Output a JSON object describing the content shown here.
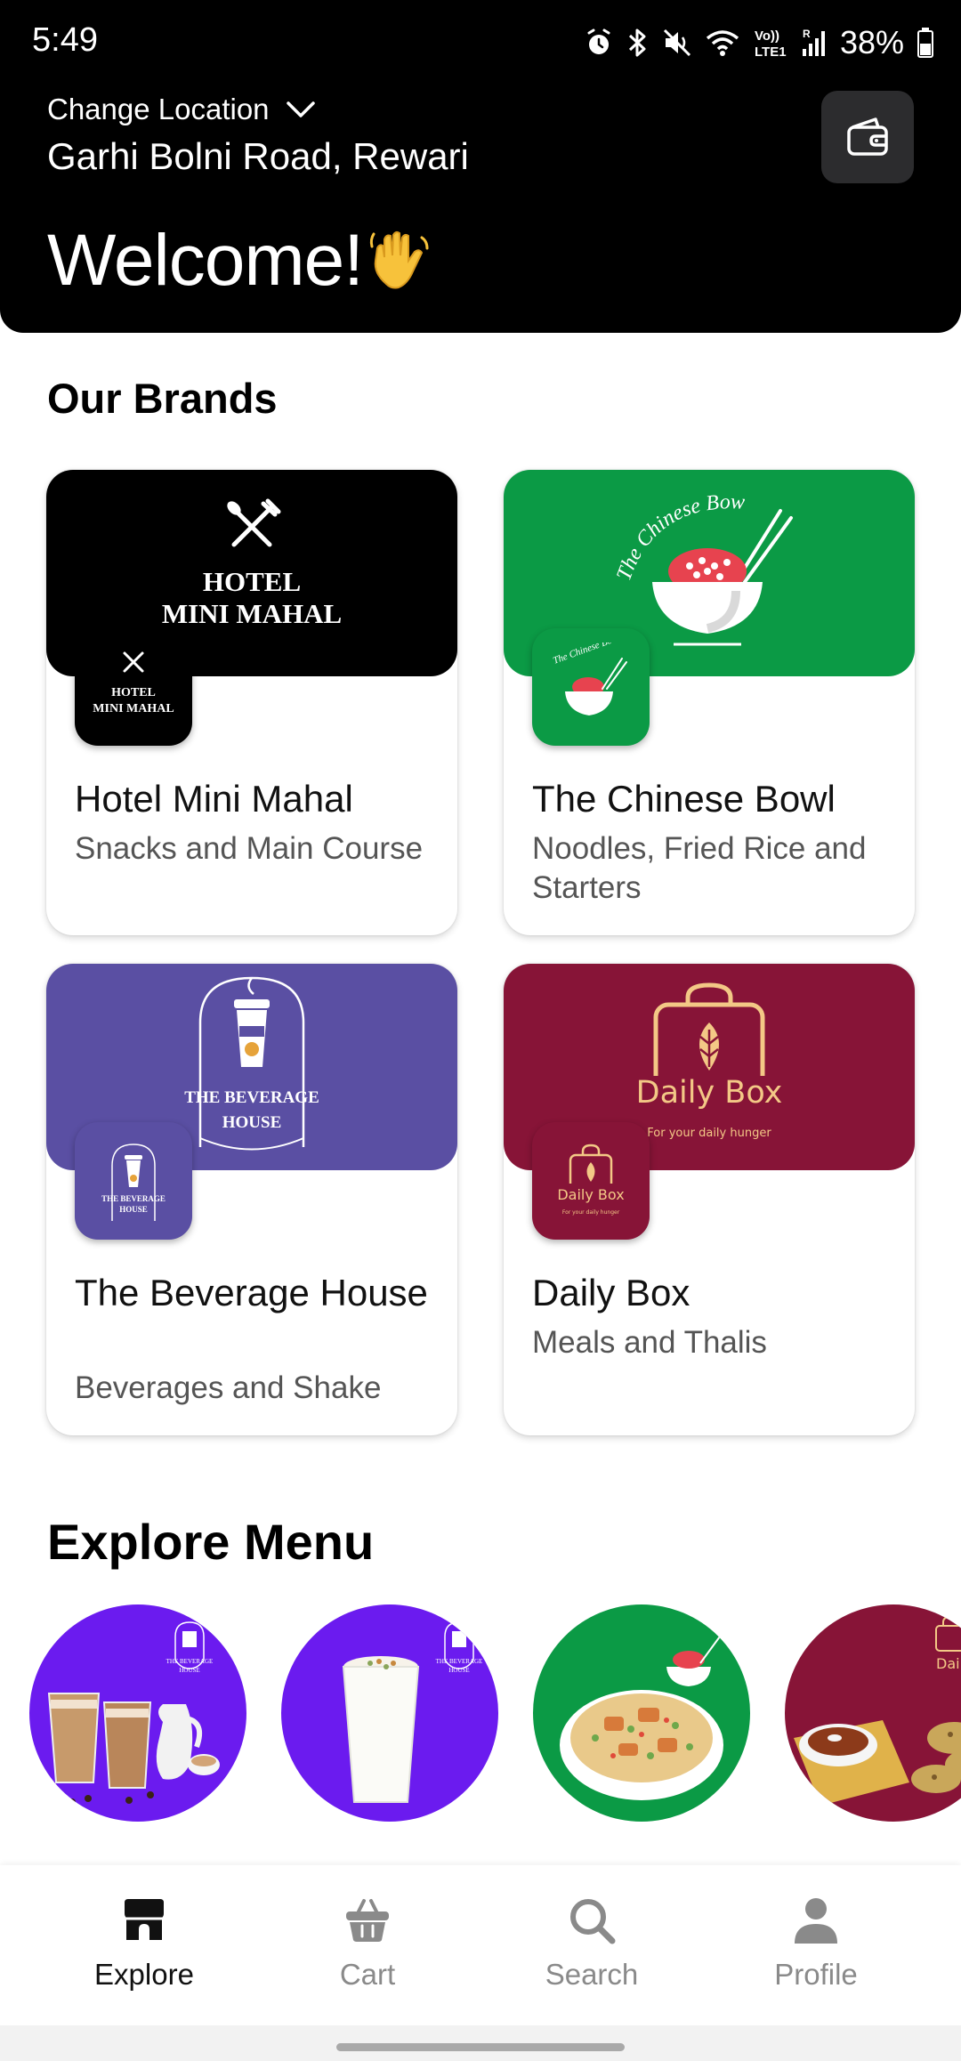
{
  "status_bar": {
    "time": "5:49",
    "battery_percent": "38%",
    "network_label": "Vo)) R\nLTE1"
  },
  "header": {
    "change_location_label": "Change Location",
    "address": "Garhi Bolni Road, Rewari",
    "welcome_text": "Welcome!",
    "wave_icon": "waving-hand-icon",
    "wallet_icon": "wallet-icon",
    "background": "#000000"
  },
  "brands_section": {
    "title": "Our Brands",
    "brands": [
      {
        "name": "Hotel Mini Mahal",
        "description": "Snacks and Main Course",
        "color": "#000000",
        "logo_text_line1": "HOTEL",
        "logo_text_line2": "MINI MAHAL"
      },
      {
        "name": "The Chinese Bowl",
        "description": "Noodles, Fried Rice and Starters",
        "color": "#0B9A45",
        "logo_text": "The Chinese Bowl"
      },
      {
        "name": "The Beverage House",
        "description": "Beverages and Shake",
        "color": "#5A4FA3",
        "logo_text_line1": "THE BEVERAGE",
        "logo_text_line2": "HOUSE"
      },
      {
        "name": "Daily Box",
        "description": "Meals and Thalis",
        "color": "#871437",
        "logo_text": "Daily Box",
        "logo_tagline": "For your daily hunger"
      }
    ]
  },
  "explore_section": {
    "title": "Explore Menu",
    "items": [
      {
        "name": "cold-coffee",
        "color": "#6B1BEF"
      },
      {
        "name": "lassi",
        "color": "#6B1BEF"
      },
      {
        "name": "fried-rice",
        "color": "#0B9A45"
      },
      {
        "name": "thali",
        "color": "#871437"
      }
    ]
  },
  "bottom_nav": {
    "items": [
      {
        "label": "Explore",
        "icon": "store-icon",
        "active": true
      },
      {
        "label": "Cart",
        "icon": "basket-icon",
        "active": false
      },
      {
        "label": "Search",
        "icon": "search-icon",
        "active": false
      },
      {
        "label": "Profile",
        "icon": "person-icon",
        "active": false
      }
    ]
  }
}
